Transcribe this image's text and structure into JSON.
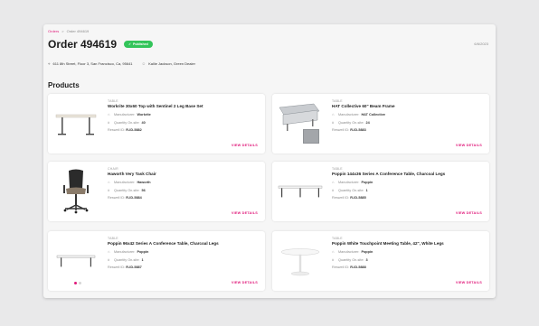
{
  "breadcrumb": {
    "link": "Orders",
    "separator": ">",
    "current": "Order 494619"
  },
  "order": {
    "title": "Order 494619",
    "status": "Published",
    "date": "6/6/2023"
  },
  "meta": {
    "address": "611 8th Street, Floor 3, San Francisco, Ca, 95641",
    "contact": "Kallie Jackson, Green Dealer"
  },
  "section_title": "Products",
  "labels": {
    "manufacturer": "Manufacturer:",
    "quantity": "Quantity On-site:",
    "reswell_id": "Reswell ID:",
    "view_details": "VIEW DETAILS"
  },
  "colors": {
    "accent": "#e0197a",
    "published": "#33c45a"
  },
  "products": [
    {
      "category": "TABLE",
      "name": "Workrite 30x60 Top with Sentinel 2 Leg Base Set",
      "manufacturer": "Workrite",
      "quantity": "40",
      "reswell_id": "R-ID-5882",
      "image_icon": "standing-desk-image"
    },
    {
      "category": "TABLE",
      "name": "HAT Collective 60\" Beam Frame",
      "manufacturer": "HAT Collective",
      "quantity": "24",
      "reswell_id": "R-ID-5883",
      "image_icon": "beam-frame-image"
    },
    {
      "category": "CHAIR",
      "name": "Haworth Very Task Chair",
      "manufacturer": "Haworth",
      "quantity": "56",
      "reswell_id": "R-ID-5884",
      "image_icon": "task-chair-image"
    },
    {
      "category": "TABLE",
      "name": "Poppin 144x36 Series A Conference Table, Charcoal Legs",
      "manufacturer": "Poppin",
      "quantity": "1",
      "reswell_id": "R-ID-5885",
      "image_icon": "conference-table-image"
    },
    {
      "category": "TABLE",
      "name": "Poppin 96x42 Series A Conference Table, Charcoal Legs",
      "manufacturer": "Poppin",
      "quantity": "1",
      "reswell_id": "R-ID-5887",
      "image_icon": "conference-table-image"
    },
    {
      "category": "TABLE",
      "name": "Poppin White Touchpoint Meeting Table, 42\", White Legs",
      "manufacturer": "Poppin",
      "quantity": "3",
      "reswell_id": "R-ID-5888",
      "image_icon": "round-table-image"
    }
  ]
}
